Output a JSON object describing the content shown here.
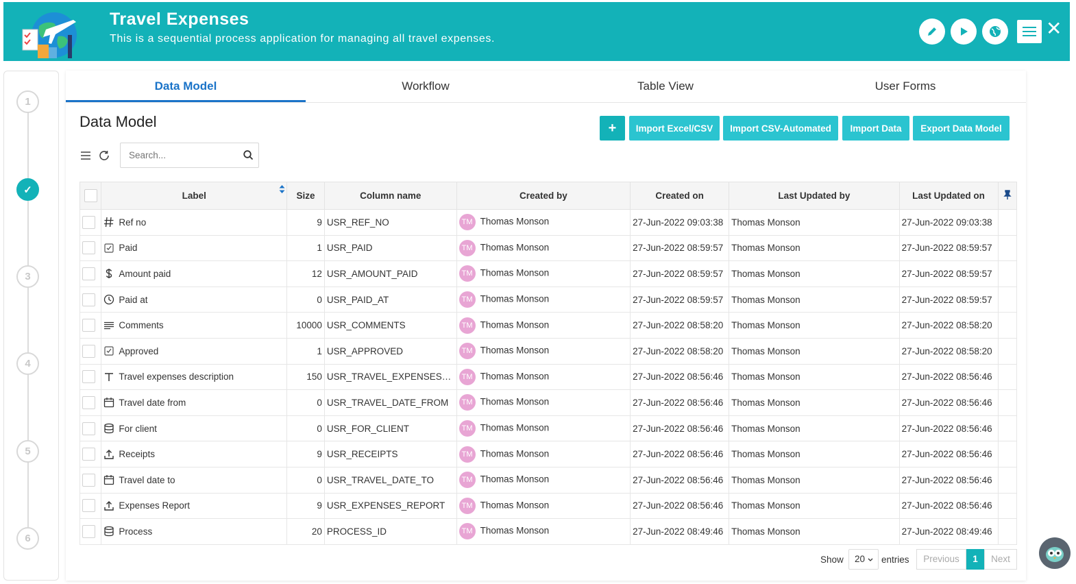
{
  "header": {
    "title": "Travel Expenses",
    "subtitle": "This is a sequential process application for managing all travel expenses.",
    "actions": [
      "pencil-icon",
      "play-icon",
      "globe-icon",
      "menu-icon",
      "close-icon"
    ],
    "close_glyph": "✕",
    "accent": "#13b2b8"
  },
  "stepper": {
    "steps": [
      "1",
      "✓",
      "3",
      "4",
      "5",
      "6"
    ],
    "completed_step": 2
  },
  "tabs": [
    {
      "label": "Data Model",
      "active": true
    },
    {
      "label": "Workflow",
      "active": false
    },
    {
      "label": "Table View",
      "active": false
    },
    {
      "label": "User Forms",
      "active": false
    }
  ],
  "page": {
    "title": "Data Model",
    "add_glyph": "+",
    "buttons": [
      "Import Excel/CSV",
      "Import CSV-Automated",
      "Import Data",
      "Export Data Model"
    ],
    "search_placeholder": "Search..."
  },
  "table": {
    "columns": [
      "Label",
      "Size",
      "Column name",
      "Created by",
      "Created on",
      "Last Updated by",
      "Last Updated on"
    ],
    "rows": [
      {
        "icon": "hash-icon",
        "label": "Ref no",
        "size": "9",
        "column": "USR_REF_NO",
        "created_by": "Thomas Monson",
        "created_on": "27-Jun-2022 09:03:38",
        "updated_by": "Thomas Monson",
        "updated_on": "27-Jun-2022 09:03:38"
      },
      {
        "icon": "checkbox-icon",
        "label": "Paid",
        "size": "1",
        "column": "USR_PAID",
        "created_by": "Thomas Monson",
        "created_on": "27-Jun-2022 08:59:57",
        "updated_by": "Thomas Monson",
        "updated_on": "27-Jun-2022 08:59:57"
      },
      {
        "icon": "dollar-icon",
        "label": "Amount paid",
        "size": "12",
        "column": "USR_AMOUNT_PAID",
        "created_by": "Thomas Monson",
        "created_on": "27-Jun-2022 08:59:57",
        "updated_by": "Thomas Monson",
        "updated_on": "27-Jun-2022 08:59:57"
      },
      {
        "icon": "clock-icon",
        "label": "Paid at",
        "size": "0",
        "column": "USR_PAID_AT",
        "created_by": "Thomas Monson",
        "created_on": "27-Jun-2022 08:59:57",
        "updated_by": "Thomas Monson",
        "updated_on": "27-Jun-2022 08:59:57"
      },
      {
        "icon": "text-lines-icon",
        "label": "Comments",
        "size": "10000",
        "column": "USR_COMMENTS",
        "created_by": "Thomas Monson",
        "created_on": "27-Jun-2022 08:58:20",
        "updated_by": "Thomas Monson",
        "updated_on": "27-Jun-2022 08:58:20"
      },
      {
        "icon": "checkbox-icon",
        "label": "Approved",
        "size": "1",
        "column": "USR_APPROVED",
        "created_by": "Thomas Monson",
        "created_on": "27-Jun-2022 08:58:20",
        "updated_by": "Thomas Monson",
        "updated_on": "27-Jun-2022 08:58:20"
      },
      {
        "icon": "text-t-icon",
        "label": "Travel expenses description",
        "size": "150",
        "column": "USR_TRAVEL_EXPENSES_DE...",
        "created_by": "Thomas Monson",
        "created_on": "27-Jun-2022 08:56:46",
        "updated_by": "Thomas Monson",
        "updated_on": "27-Jun-2022 08:56:46"
      },
      {
        "icon": "calendar-icon",
        "label": "Travel date from",
        "size": "0",
        "column": "USR_TRAVEL_DATE_FROM",
        "created_by": "Thomas Monson",
        "created_on": "27-Jun-2022 08:56:46",
        "updated_by": "Thomas Monson",
        "updated_on": "27-Jun-2022 08:56:46"
      },
      {
        "icon": "database-icon",
        "label": "For client",
        "size": "0",
        "column": "USR_FOR_CLIENT",
        "created_by": "Thomas Monson",
        "created_on": "27-Jun-2022 08:56:46",
        "updated_by": "Thomas Monson",
        "updated_on": "27-Jun-2022 08:56:46"
      },
      {
        "icon": "upload-icon",
        "label": "Receipts",
        "size": "9",
        "column": "USR_RECEIPTS",
        "created_by": "Thomas Monson",
        "created_on": "27-Jun-2022 08:56:46",
        "updated_by": "Thomas Monson",
        "updated_on": "27-Jun-2022 08:56:46"
      },
      {
        "icon": "calendar-icon",
        "label": "Travel date to",
        "size": "0",
        "column": "USR_TRAVEL_DATE_TO",
        "created_by": "Thomas Monson",
        "created_on": "27-Jun-2022 08:56:46",
        "updated_by": "Thomas Monson",
        "updated_on": "27-Jun-2022 08:56:46"
      },
      {
        "icon": "upload-icon",
        "label": "Expenses Report",
        "size": "9",
        "column": "USR_EXPENSES_REPORT",
        "created_by": "Thomas Monson",
        "created_on": "27-Jun-2022 08:56:46",
        "updated_by": "Thomas Monson",
        "updated_on": "27-Jun-2022 08:56:46"
      },
      {
        "icon": "database-icon",
        "label": "Process",
        "size": "20",
        "column": "PROCESS_ID",
        "created_by": "Thomas Monson",
        "created_on": "27-Jun-2022 08:49:46",
        "updated_by": "Thomas Monson",
        "updated_on": "27-Jun-2022 08:49:46"
      }
    ],
    "avatar_initials": "TM",
    "avatar_color": "#e8a5d4"
  },
  "pagination": {
    "show_label": "Show",
    "page_size": "20",
    "entries_label": "entries",
    "previous": "Previous",
    "current": "1",
    "next": "Next"
  }
}
